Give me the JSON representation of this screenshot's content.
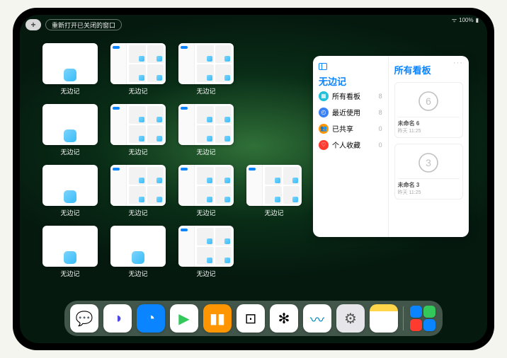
{
  "status": {
    "battery": "100%",
    "signal": "wifi"
  },
  "topbar": {
    "plus": "+",
    "reopen_label": "重新打开已关闭的窗口"
  },
  "appswitcher": {
    "app_label": "无边记",
    "windows": [
      {
        "kind": "blank"
      },
      {
        "kind": "grid"
      },
      {
        "kind": "grid"
      },
      {
        "kind": "blank"
      },
      {
        "kind": "grid"
      },
      {
        "kind": "grid"
      },
      {
        "kind": "blank"
      },
      {
        "kind": "grid"
      },
      {
        "kind": "grid"
      },
      {
        "kind": "grid"
      },
      {
        "kind": "blank"
      },
      {
        "kind": "blank"
      },
      {
        "kind": "grid"
      }
    ]
  },
  "panel": {
    "title": "无边记",
    "more": "···",
    "items": [
      {
        "icon_color": "#20c0d8",
        "label": "所有看板",
        "count": "8"
      },
      {
        "icon_color": "#3b82f6",
        "label": "最近使用",
        "count": "8"
      },
      {
        "icon_color": "#ff9500",
        "label": "已共享",
        "count": "0"
      },
      {
        "icon_color": "#ff3b30",
        "label": "个人收藏",
        "count": "0"
      }
    ],
    "right_title": "所有看板",
    "boards": [
      {
        "digit": "6",
        "name": "未命名 6",
        "time": "昨天 11:25"
      },
      {
        "digit": "3",
        "name": "未命名 3",
        "time": "昨天 11:25"
      }
    ]
  },
  "dock": {
    "apps": [
      {
        "name": "wechat",
        "bg": "#ffffff",
        "emoji": "💬",
        "tint": "#07c160"
      },
      {
        "name": "quark-hd",
        "bg": "#ffffff",
        "emoji": "◑",
        "tint": "#4f46e5"
      },
      {
        "name": "quark",
        "bg": "#0a84ff",
        "emoji": "◔",
        "tint": "#ffffff"
      },
      {
        "name": "play",
        "bg": "#ffffff",
        "emoji": "▶",
        "tint": "#34c759"
      },
      {
        "name": "books",
        "bg": "#ff9500",
        "emoji": "▮▮",
        "tint": "#ffffff"
      },
      {
        "name": "dice",
        "bg": "#ffffff",
        "emoji": "⊡",
        "tint": "#000000"
      },
      {
        "name": "audioshare",
        "bg": "#ffffff",
        "emoji": "✻",
        "tint": "#000000"
      },
      {
        "name": "freeform",
        "bg": "#ffffff",
        "emoji": "〰",
        "tint": "#08b"
      },
      {
        "name": "settings",
        "bg": "#e5e5ea",
        "emoji": "⚙",
        "tint": "#555"
      },
      {
        "name": "notes",
        "bg": "#fff",
        "emoji": "",
        "tint": ""
      }
    ],
    "recent_grid": [
      "#0a84ff",
      "#34c759",
      "#ff3b30",
      "#0a84ff"
    ]
  }
}
